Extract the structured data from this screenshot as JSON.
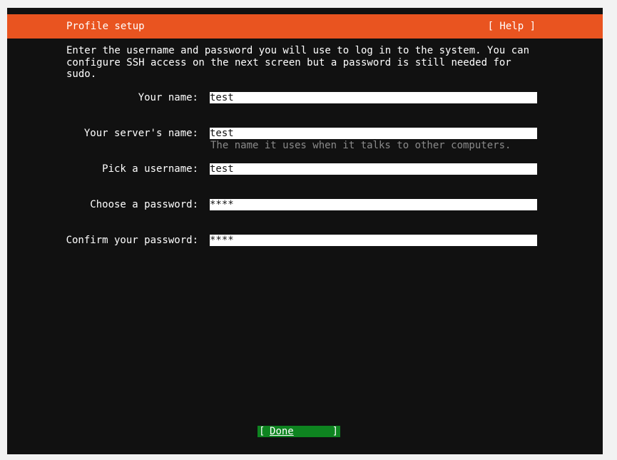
{
  "header": {
    "title": "Profile setup",
    "help_label": "[ Help ]"
  },
  "intro": {
    "text": "Enter the username and password you will use to log in to the system. You can\nconfigure SSH access on the next screen but a password is still needed for\nsudo."
  },
  "form": {
    "your_name": {
      "label": "Your name:",
      "value": "test"
    },
    "server_name": {
      "label": "Your server's name:",
      "value": "test",
      "hint": "The name it uses when it talks to other computers."
    },
    "username": {
      "label": "Pick a username:",
      "value": "test"
    },
    "password": {
      "label": "Choose a password:",
      "value": "****"
    },
    "confirm_password": {
      "label": "Confirm your password:",
      "value": "****"
    }
  },
  "footer": {
    "done_label": "Done",
    "left_bracket": "[",
    "right_bracket": "]"
  },
  "colors": {
    "accent": "#e95420",
    "background": "#111111",
    "button": "#0e8420",
    "hint": "#8a8a8a"
  }
}
